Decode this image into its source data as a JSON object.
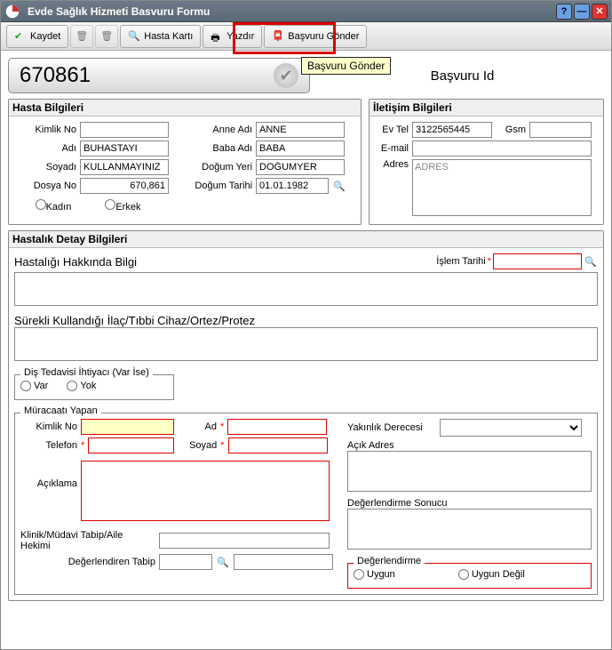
{
  "window": {
    "title": "Evde Sağlık Hizmeti Basvuru Formu"
  },
  "icons": {
    "kaydet": "✔",
    "sil": "🗑",
    "hastakarti": "🔍",
    "yazdir": "🖶",
    "gonder": "📮",
    "close": "✕",
    "min": "—",
    "help": "?",
    "check": "✔",
    "search": "🔍"
  },
  "toolbar": {
    "kaydet": "Kaydet",
    "hastakarti": "Hasta Kartı",
    "yazdir": "Yazdır",
    "gonder": "Başvuru Gönder"
  },
  "tooltip": "Başvuru Gönder",
  "basvuru": {
    "id": "670861",
    "id_label": "Başvuru Id"
  },
  "hasta": {
    "section": "Hasta Bilgileri",
    "labels": {
      "kimlik": "Kimlik No",
      "ad": "Adı",
      "soyad": "Soyadı",
      "dosya": "Dosya No",
      "anne": "Anne Adı",
      "baba": "Baba Adı",
      "dogum_yeri": "Doğum Yeri",
      "dogum_tarihi": "Doğum Tarihi",
      "kadin": "Kadın",
      "erkek": "Erkek"
    },
    "values": {
      "kimlik": "",
      "ad": "BUHASTAYI",
      "soyad": "KULLANMAYINIZ",
      "dosya": "670,861",
      "anne": "ANNE",
      "baba": "BABA",
      "dogum_yeri": "DOĞUMYER",
      "dogum_tarihi": "01.01.1982"
    }
  },
  "iletisim": {
    "section": "İletişim Bilgileri",
    "labels": {
      "evtel": "Ev Tel",
      "gsm": "Gsm",
      "email": "E-mail",
      "adres": "Adres"
    },
    "values": {
      "evtel": "3122565445",
      "gsm": "",
      "email": "",
      "adres": "ADRES"
    }
  },
  "detay": {
    "section": "Hastalık Detay Bilgileri",
    "hakkinda": "Hastalığı Hakkında Bilgi",
    "islem_tarihi": "İşlem Tarihi",
    "ilac": "Sürekli Kullandığı İlaç/Tıbbi Cihaz/Ortez/Protez",
    "dis": {
      "legend": "Diş Tedavisi İhtiyacı (Var İse)",
      "var": "Var",
      "yok": "Yok"
    }
  },
  "muracaat": {
    "legend": "Müracaatı Yapan",
    "labels": {
      "kimlik": "Kimlik No",
      "telefon": "Telefon",
      "aciklama": "Açıklama",
      "ad": "Ad",
      "soyad": "Soyad",
      "yakinlik": "Yakınlık Derecesi",
      "acik_adres": "Açık Adres",
      "deg_sonucu": "Değerlendirme Sonucu",
      "klinik": "Klinik/Müdavi Tabip/Aile Hekimi",
      "deg_tabip": "Değerlendiren Tabip"
    },
    "degerlendirme": {
      "legend": "Değerlendirme",
      "uygun": "Uygun",
      "uygundegil": "Uygun Değil"
    }
  }
}
